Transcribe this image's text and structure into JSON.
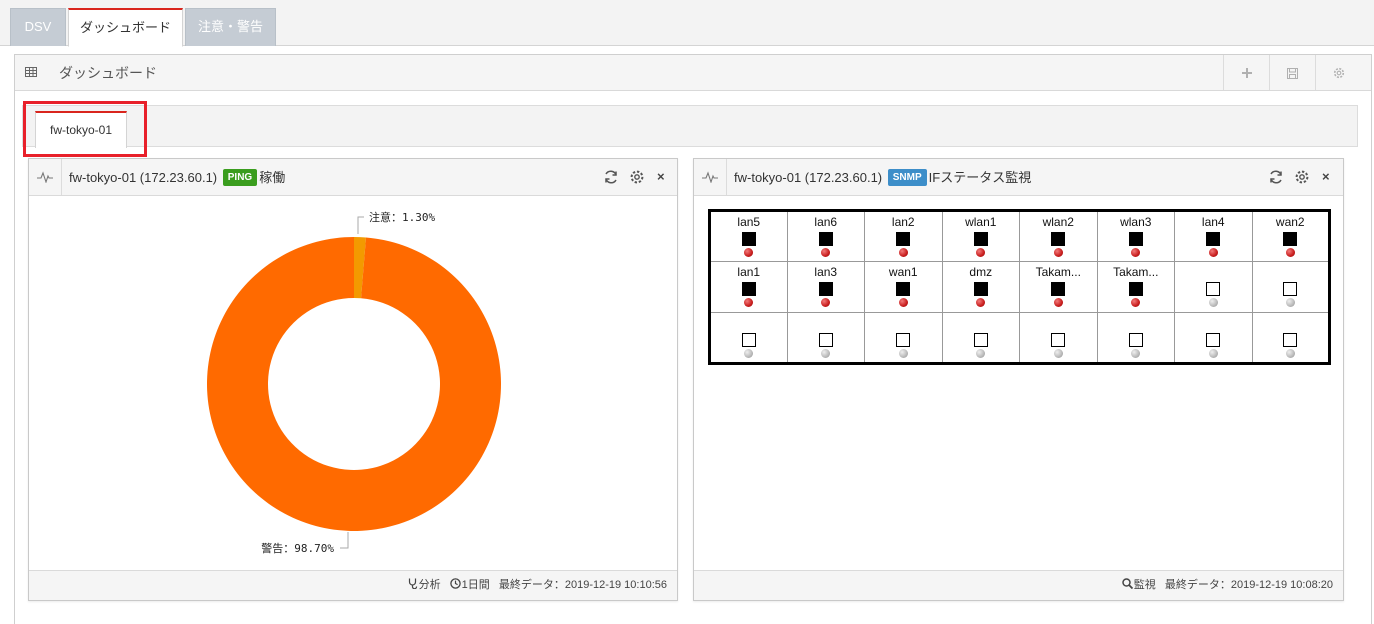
{
  "top_tabs": [
    {
      "label": "DSV",
      "active": false
    },
    {
      "label": "ダッシュボード",
      "active": true
    },
    {
      "label": "注意・警告",
      "active": false
    }
  ],
  "dashboard": {
    "title": "ダッシュボード",
    "icons": {
      "header": "grid-icon",
      "add": "plus-icon",
      "save": "save-icon",
      "settings": "gear-icon"
    }
  },
  "sub_tabs": [
    {
      "label": "fw-tokyo-01",
      "active": true
    }
  ],
  "widgets": {
    "ping": {
      "title_prefix": "fw-tokyo-01 (172.23.60.1)",
      "badge": "PING",
      "badge_color": "#3a9d1e",
      "title_suffix": "稼働",
      "footer": {
        "analysis": "分析",
        "period": "1日間",
        "last_data": "最終データ：2019-12-19 10:10:56"
      }
    },
    "snmp": {
      "title_prefix": "fw-tokyo-01 (172.23.60.1)",
      "badge": "SNMP",
      "badge_color": "#3d8ec9",
      "title_suffix": "IFステータス監視",
      "footer": {
        "monitor": "監視",
        "last_data": "最終データ：2019-12-19 10:08:20"
      },
      "interfaces": [
        [
          {
            "name": "lan5",
            "filled": true,
            "led": "red"
          },
          {
            "name": "lan6",
            "filled": true,
            "led": "red"
          },
          {
            "name": "lan2",
            "filled": true,
            "led": "red"
          },
          {
            "name": "wlan1",
            "filled": true,
            "led": "red"
          },
          {
            "name": "wlan2",
            "filled": true,
            "led": "red"
          },
          {
            "name": "wlan3",
            "filled": true,
            "led": "red"
          },
          {
            "name": "lan4",
            "filled": true,
            "led": "red"
          },
          {
            "name": "wan2",
            "filled": true,
            "led": "red"
          }
        ],
        [
          {
            "name": "lan1",
            "filled": true,
            "led": "red"
          },
          {
            "name": "lan3",
            "filled": true,
            "led": "red"
          },
          {
            "name": "wan1",
            "filled": true,
            "led": "red"
          },
          {
            "name": "dmz",
            "filled": true,
            "led": "red"
          },
          {
            "name": "Takam...",
            "filled": true,
            "led": "red"
          },
          {
            "name": "Takam...",
            "filled": true,
            "led": "red"
          },
          {
            "name": "",
            "filled": false,
            "led": "grey"
          },
          {
            "name": "",
            "filled": false,
            "led": "grey"
          }
        ],
        [
          {
            "name": "",
            "filled": false,
            "led": "grey"
          },
          {
            "name": "",
            "filled": false,
            "led": "grey"
          },
          {
            "name": "",
            "filled": false,
            "led": "grey"
          },
          {
            "name": "",
            "filled": false,
            "led": "grey"
          },
          {
            "name": "",
            "filled": false,
            "led": "grey"
          },
          {
            "name": "",
            "filled": false,
            "led": "grey"
          },
          {
            "name": "",
            "filled": false,
            "led": "grey"
          },
          {
            "name": "",
            "filled": false,
            "led": "grey"
          }
        ]
      ]
    }
  },
  "chart_data": {
    "type": "pie",
    "donut": true,
    "title": "",
    "slices": [
      {
        "label": "注意",
        "value": 1.3,
        "display": "注意：1.30%",
        "color": "#f39a00"
      },
      {
        "label": "警告",
        "value": 98.7,
        "display": "警告：98.70%",
        "color": "#ff6a00"
      }
    ]
  }
}
